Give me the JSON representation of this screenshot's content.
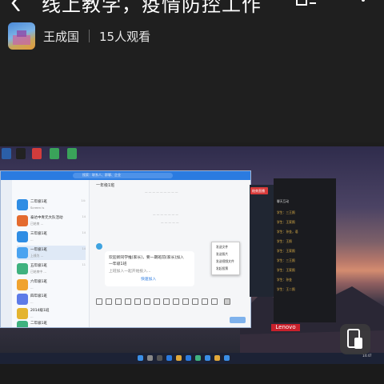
{
  "header": {
    "title": "线上教学，疫情防控工作",
    "author": "王成国",
    "view_count": "15人观看"
  },
  "video": {
    "chat": {
      "search_placeholder": "搜索：联系人、群聊、企业",
      "title": "一年级1班",
      "conversations": [
        {
          "name": "二年级1班",
          "msg": "Screen is",
          "time": "14:",
          "color": "#2f8de4"
        },
        {
          "name": "泰达中青元大队活动",
          "msg": "已结束 ...",
          "time": "14",
          "color": "#e46b2f"
        },
        {
          "name": "三年级1班",
          "msg": "...",
          "time": "14",
          "color": "#2f8de4"
        },
        {
          "name": "一年级1班",
          "msg": "上线为 ...",
          "time": "14",
          "color": "#4aa3f0"
        },
        {
          "name": "五年级1班",
          "msg": "已结束中 ...",
          "time": "11",
          "color": "#3fb27f"
        },
        {
          "name": "六年级1班",
          "msg": "...",
          "time": "",
          "color": "#f0a32f"
        },
        {
          "name": "四年级1班",
          "msg": "...",
          "time": "",
          "color": "#5d7be8"
        },
        {
          "name": "2014级1班",
          "msg": "...",
          "time": "",
          "color": "#e4b42f"
        },
        {
          "name": "二年级1班",
          "msg": "...",
          "time": "",
          "color": "#3fb27f"
        }
      ],
      "bubble_lines": [
        "欢迎新同学推(家长)，要一期班前(家长)加入",
        "一年级1班",
        "上班加入一起开始投入...",
        "快速加入"
      ],
      "menu_items": [
        "发送文件",
        "发送照片",
        "发送视频文件",
        "发起投票"
      ]
    },
    "live_panel": {
      "button": "结束直播",
      "lines": [
        "聊天互动",
        "学生：三王照",
        "学生：王家照",
        "学生：孙金，语",
        "学生：王照",
        "学生：王家照",
        "学生：三王照",
        "学生：王家照",
        "学生：孙金",
        "学生：王二照"
      ]
    },
    "brand": "Lenovo",
    "taskbar_time": "14:47"
  }
}
